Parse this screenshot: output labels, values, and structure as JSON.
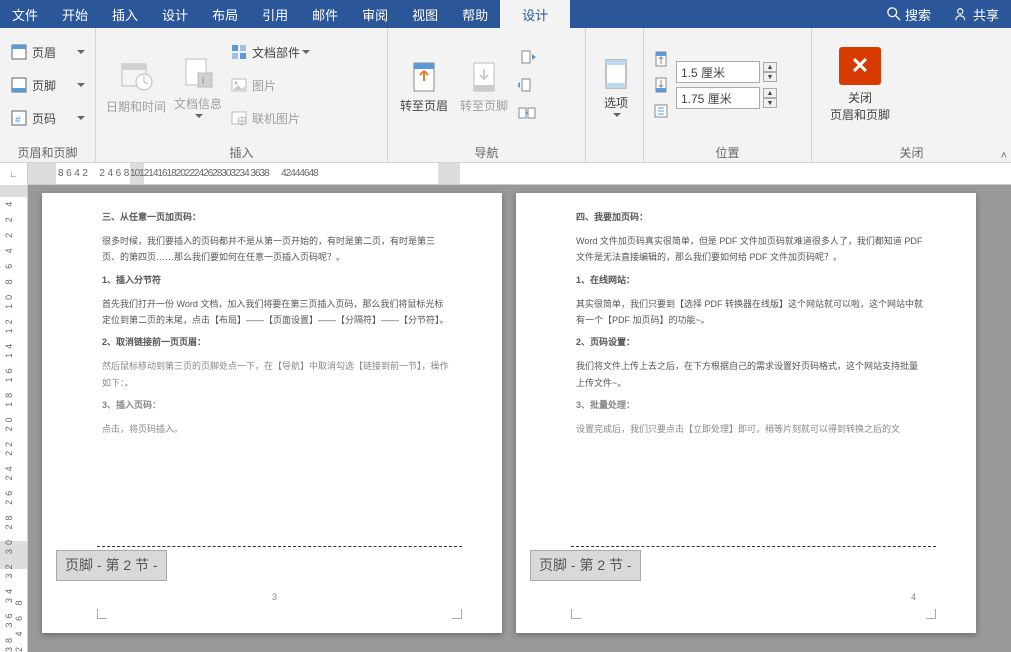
{
  "menu": {
    "file": "文件",
    "home": "开始",
    "insert": "插入",
    "design": "设计",
    "layout": "布局",
    "references": "引用",
    "mail": "邮件",
    "review": "审阅",
    "view": "视图",
    "help": "帮助",
    "context": "设计",
    "search": "搜索",
    "share": "共享"
  },
  "ribbon": {
    "group_hf": {
      "header": "页眉",
      "footer": "页脚",
      "pagenum": "页码",
      "label": "页眉和页脚"
    },
    "group_insert": {
      "datetime": "日期和时间",
      "docinfo": "文档信息",
      "parts": "文档部件",
      "picture": "图片",
      "online_pic": "联机图片",
      "label": "插入"
    },
    "group_nav": {
      "goto_header": "转至页眉",
      "goto_footer": "转至页脚",
      "label": "导航"
    },
    "group_options": {
      "options": "选项",
      "label": ""
    },
    "group_position": {
      "top": "1.5 厘米",
      "bottom": "1.75 厘米",
      "label": "位置"
    },
    "group_close": {
      "close1": "关闭",
      "close2": "页眉和页脚",
      "label": "关闭"
    }
  },
  "ruler": {
    "h": "8  6  4  2       2  4  6  8 10121416182022242628303234 3638       42444648",
    "v": "38 36 34 32 30 28 26 24 22 20 18 16 14 12 10  8  6  4  2        2  4        2  4  6  8"
  },
  "footer_tag": "页脚 - 第 2 节 -",
  "pages": {
    "left": {
      "h1": "三、从任意一页加页码：",
      "p1": "很多时候，我们要插入的页码都并不是从第一页开始的，有时是第二页，有时是第三页、的第四页……那么我们要如何在任意一页插入页码呢？。",
      "h2": "1、插入分节符",
      "p2": "首先我们打开一份 Word 文档，加入我们将要在第三页插入页码，那么我们将鼠标光标定位到第二页的末尾，点击【布局】——【页面设置】——【分隔符】——【分节符】。",
      "h3": "2、取消链接前一页页眉：",
      "p3": "然后鼠标移动到第三页的页脚处点一下，在【导航】中取消勾选【链接到前一节】，操作如下：。",
      "h4": "3、插入页码：",
      "p4": "点击，将页码插入。",
      "page_num": "3"
    },
    "right": {
      "h1": "四、我要加页码：",
      "p1": "Word 文件加页码真实很简单，但是 PDF 文件加页码就难道很多人了，我们都知道 PDF 文件是无法直接编辑的，那么我们要如何给 PDF 文件加页码呢？。",
      "h2": "1、在线网站：",
      "p2": "其实很简单，我们只要到【选择 PDF 转换器在线版】这个网站就可以啦，这个网站中就有一个【PDF 加页码】的功能~。",
      "h3": "2、页码设置：",
      "p3": "我们将文件上传上去之后，在下方根据自己的需求设置好页码格式，这个网站支持批量上传文件~。",
      "h4": "3、批量处理：",
      "p4": "设置完成后，我们只要点击【立即处理】即可，稍等片刻就可以得到转换之后的文",
      "page_num": "4"
    }
  }
}
